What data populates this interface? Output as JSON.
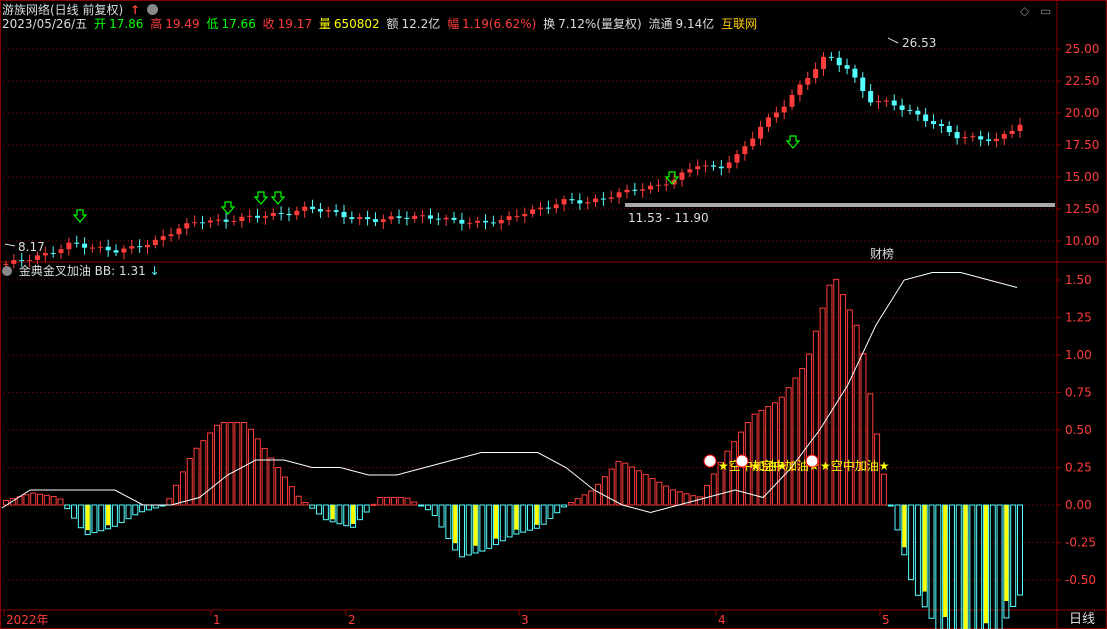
{
  "header": {
    "title": "游族网络(日线 前复权)",
    "date": "2023/05/26/五",
    "open_label": "开",
    "open": "17.86",
    "high_label": "高",
    "high": "19.49",
    "low_label": "低",
    "low": "17.66",
    "close_label": "收",
    "close": "19.17",
    "volume_label": "量",
    "volume": "650802",
    "amount_label": "额",
    "amount": "12.2亿",
    "change_label": "幅",
    "change": "1.19(6.62%)",
    "turnover_label": "换",
    "turnover": "7.12%(量复权)",
    "float_label": "流通",
    "float": "9.14亿",
    "sector": "互联网"
  },
  "indicator": {
    "name": "金典金叉加油",
    "bb_label": "BB:",
    "bb_value": "1.31"
  },
  "price_panel": {
    "y_ticks": [
      "25.00",
      "22.50",
      "20.00",
      "17.50",
      "15.00",
      "12.50",
      "10.00"
    ],
    "high_marker": "26.53",
    "low_marker": "8.17",
    "range_label": "11.53 - 11.90",
    "badge": "财榜"
  },
  "indicator_panel": {
    "y_ticks": [
      "1.50",
      "1.25",
      "1.00",
      "0.75",
      "0.50",
      "0.25",
      "0.00",
      "-0.25",
      "-0.50"
    ],
    "signal_texts": [
      "空中加油",
      "空中加油",
      "空中加油"
    ]
  },
  "x_axis": {
    "labels": [
      "2022年",
      "1",
      "2",
      "3",
      "4",
      "5"
    ],
    "period": "日线"
  },
  "colors": {
    "up": "#ff3c3c",
    "down": "#54ffff",
    "ma_line": "#ffffff",
    "yellow_bar": "#ffff00",
    "grid": "#8b0000"
  },
  "chart_data": {
    "type": "candlestick",
    "price": {
      "x": [
        "2022年",
        "1",
        "2",
        "3",
        "4",
        "5"
      ],
      "close_trend": [
        8.2,
        8.6,
        9.0,
        9.8,
        9.5,
        9.2,
        9.5,
        10.0,
        11.0,
        11.6,
        11.5,
        11.8,
        12.0,
        12.1,
        12.6,
        12.3,
        11.8,
        11.6,
        11.8,
        11.9,
        11.8,
        11.5,
        11.4,
        11.6,
        12.2,
        12.6,
        13.2,
        13.0,
        13.5,
        14.0,
        14.2,
        14.8,
        16.0,
        15.6,
        16.8,
        19.0,
        20.5,
        22.5,
        24.5,
        23.5,
        21.0,
        20.8,
        20.0,
        19.2,
        18.2,
        18.0,
        17.9,
        19.17
      ],
      "ylim": [
        8,
        27
      ]
    },
    "indicator": {
      "bars": [
        0.03,
        0.08,
        0.05,
        -0.2,
        -0.15,
        -0.05,
        0.0,
        0.35,
        0.55,
        0.55,
        0.3,
        0.05,
        -0.1,
        -0.15,
        0.05,
        0.05,
        -0.05,
        -0.35,
        -0.3,
        -0.2,
        -0.15,
        0.0,
        0.1,
        0.3,
        0.2,
        0.1,
        0.05,
        0.35,
        0.6,
        0.7,
        0.95,
        1.55,
        1.15,
        0.1,
        -0.55,
        -0.85,
        -1.0,
        -0.9,
        -0.6
      ],
      "line": [
        -0.02,
        0.1,
        0.1,
        0.1,
        0.1,
        0.0,
        0.0,
        0.05,
        0.2,
        0.3,
        0.3,
        0.25,
        0.25,
        0.2,
        0.2,
        0.25,
        0.3,
        0.35,
        0.35,
        0.35,
        0.25,
        0.1,
        0.0,
        -0.05,
        0.0,
        0.05,
        0.1,
        0.05,
        0.25,
        0.5,
        0.8,
        1.2,
        1.5,
        1.55,
        1.55,
        1.5,
        1.45
      ],
      "ylim": [
        -0.7,
        1.6
      ]
    }
  }
}
